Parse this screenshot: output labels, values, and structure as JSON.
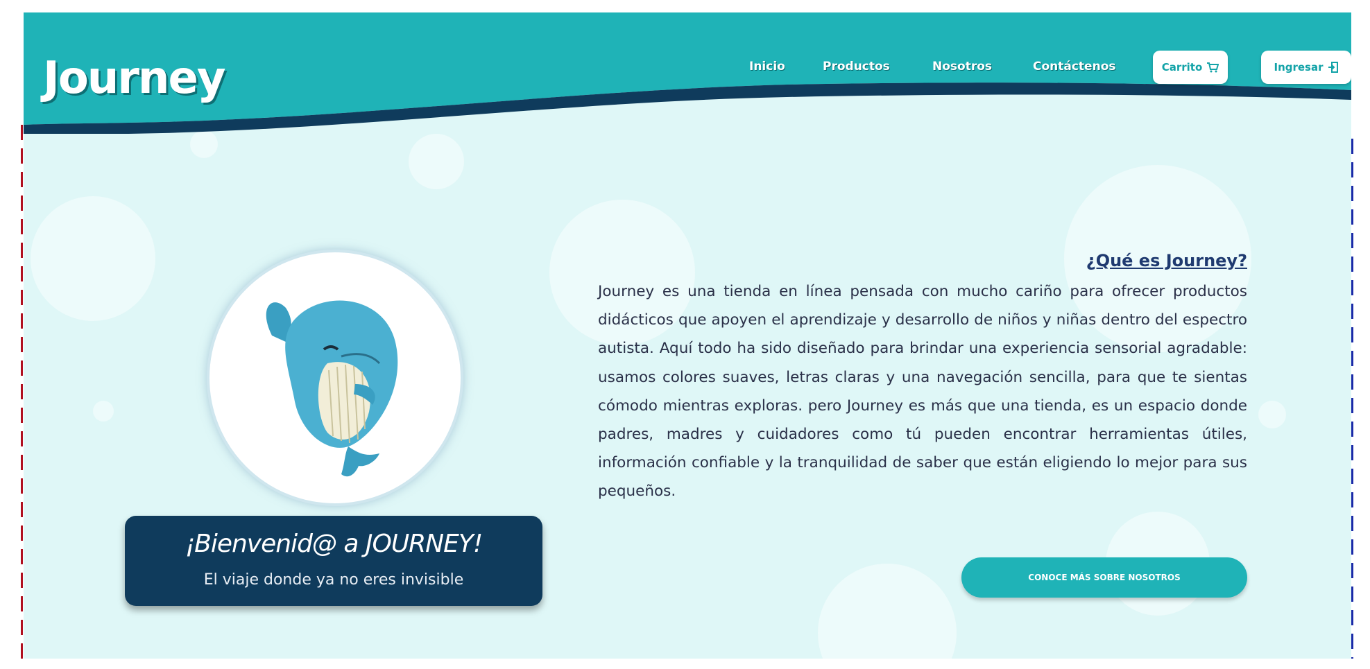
{
  "brand": {
    "logo_text": "Journey"
  },
  "nav": {
    "items": [
      "Inicio",
      "Productos",
      "Nosotros",
      "Contáctenos"
    ],
    "cart_label": "Carrito",
    "login_label": "Ingresar"
  },
  "hero": {
    "welcome_title": "¡Bienvenid@ a JOURNEY!",
    "welcome_subtitle": "El viaje donde ya no eres invisible"
  },
  "about": {
    "title": "¿Qué es Journey?",
    "body": "Journey es una tienda en línea pensada con mucho cariño para ofrecer productos didácticos que apoyen el aprendizaje y desarrollo de niños y niñas dentro del espectro autista. Aquí todo ha sido diseñado para brindar una experiencia sensorial agradable: usamos colores suaves, letras claras y una navegación sencilla, para que te sientas cómodo mientras exploras. pero Journey es más que una tienda, es un espacio donde padres, madres y cuidadores como tú pueden encontrar herramientas útiles, información confiable y la tranquilidad de saber que están eligiendo lo mejor para sus pequeños.",
    "cta_label": "CONOCE MÁS SOBRE NOSOTROS"
  },
  "colors": {
    "header_teal": "#1fb3b7",
    "header_dark_wave": "#0f3b5c",
    "background": "#dff7f7",
    "welcome_card": "#0f3b5c",
    "cta_button": "#1fb3b7"
  },
  "icons": {
    "cart": "cart-icon",
    "login": "login-icon",
    "whale": "whale-illustration"
  }
}
